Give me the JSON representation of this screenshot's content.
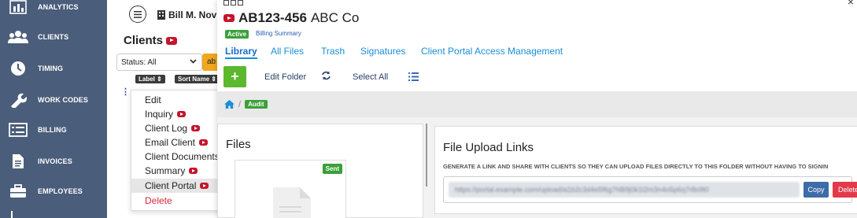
{
  "sidebar": {
    "items": [
      {
        "label": "ANALYTICS",
        "icon": "bar-chart-icon"
      },
      {
        "label": "CLIENTS",
        "icon": "people-icon"
      },
      {
        "label": "TIMING",
        "icon": "clock-icon"
      },
      {
        "label": "WORK CODES",
        "icon": "wrench-icon"
      },
      {
        "label": "BILLING",
        "icon": "list-icon"
      },
      {
        "label": "INVOICES",
        "icon": "document-icon"
      },
      {
        "label": "EMPLOYEES",
        "icon": "briefcase-icon"
      }
    ]
  },
  "header": {
    "user_name": "Bill M. Nov"
  },
  "clients_pane": {
    "title": "Clients",
    "status_select": "Status: All",
    "orange_chip": "ab",
    "sort_buttons": [
      "Label ⇕",
      "Sort Name ⇕"
    ],
    "context_menu": [
      {
        "label": "Edit",
        "video": false
      },
      {
        "label": "Inquiry",
        "video": true
      },
      {
        "label": "Client Log",
        "video": true
      },
      {
        "label": "Email Client",
        "video": true
      },
      {
        "label": "Client Documents",
        "video": false
      },
      {
        "label": "Summary",
        "video": true
      },
      {
        "label": "Client Portal",
        "video": true
      },
      {
        "label": "Delete",
        "video": false
      }
    ]
  },
  "main": {
    "client_id": "AB123-456",
    "client_name": "ABC Co",
    "status_badge": "Active",
    "billing_summary_link": "Billing Summary",
    "tabs": [
      "Library",
      "All Files",
      "Trash",
      "Signatures",
      "Client Portal Access Management"
    ],
    "toolbar": {
      "add": "+",
      "edit_folder": "Edit Folder",
      "select_all": "Select All"
    },
    "breadcrumb": {
      "folder": "Audit"
    },
    "files": {
      "title": "Files",
      "sent_badge": "Sent"
    },
    "upload": {
      "title": "File Upload Links",
      "description": "GENERATE A LINK AND SHARE WITH CLIENTS SO THEY CAN UPLOAD FILES DIRECTLY TO THIS FOLDER WITHOUT HAVING TO SIGNIN",
      "link_value": "https://portal.example.com/upload/a1b2c3d4e5f6g7h8i9j0k1l2m3n4o5p6q7r8s9t0",
      "copy_label": "Copy",
      "delete_label": "Delete"
    }
  },
  "colors": {
    "sidebar": "#4a5d7a",
    "accent_blue": "#1a8fd8",
    "green": "#3aa03a",
    "red": "#c4142b",
    "orange": "#f0a81e"
  }
}
